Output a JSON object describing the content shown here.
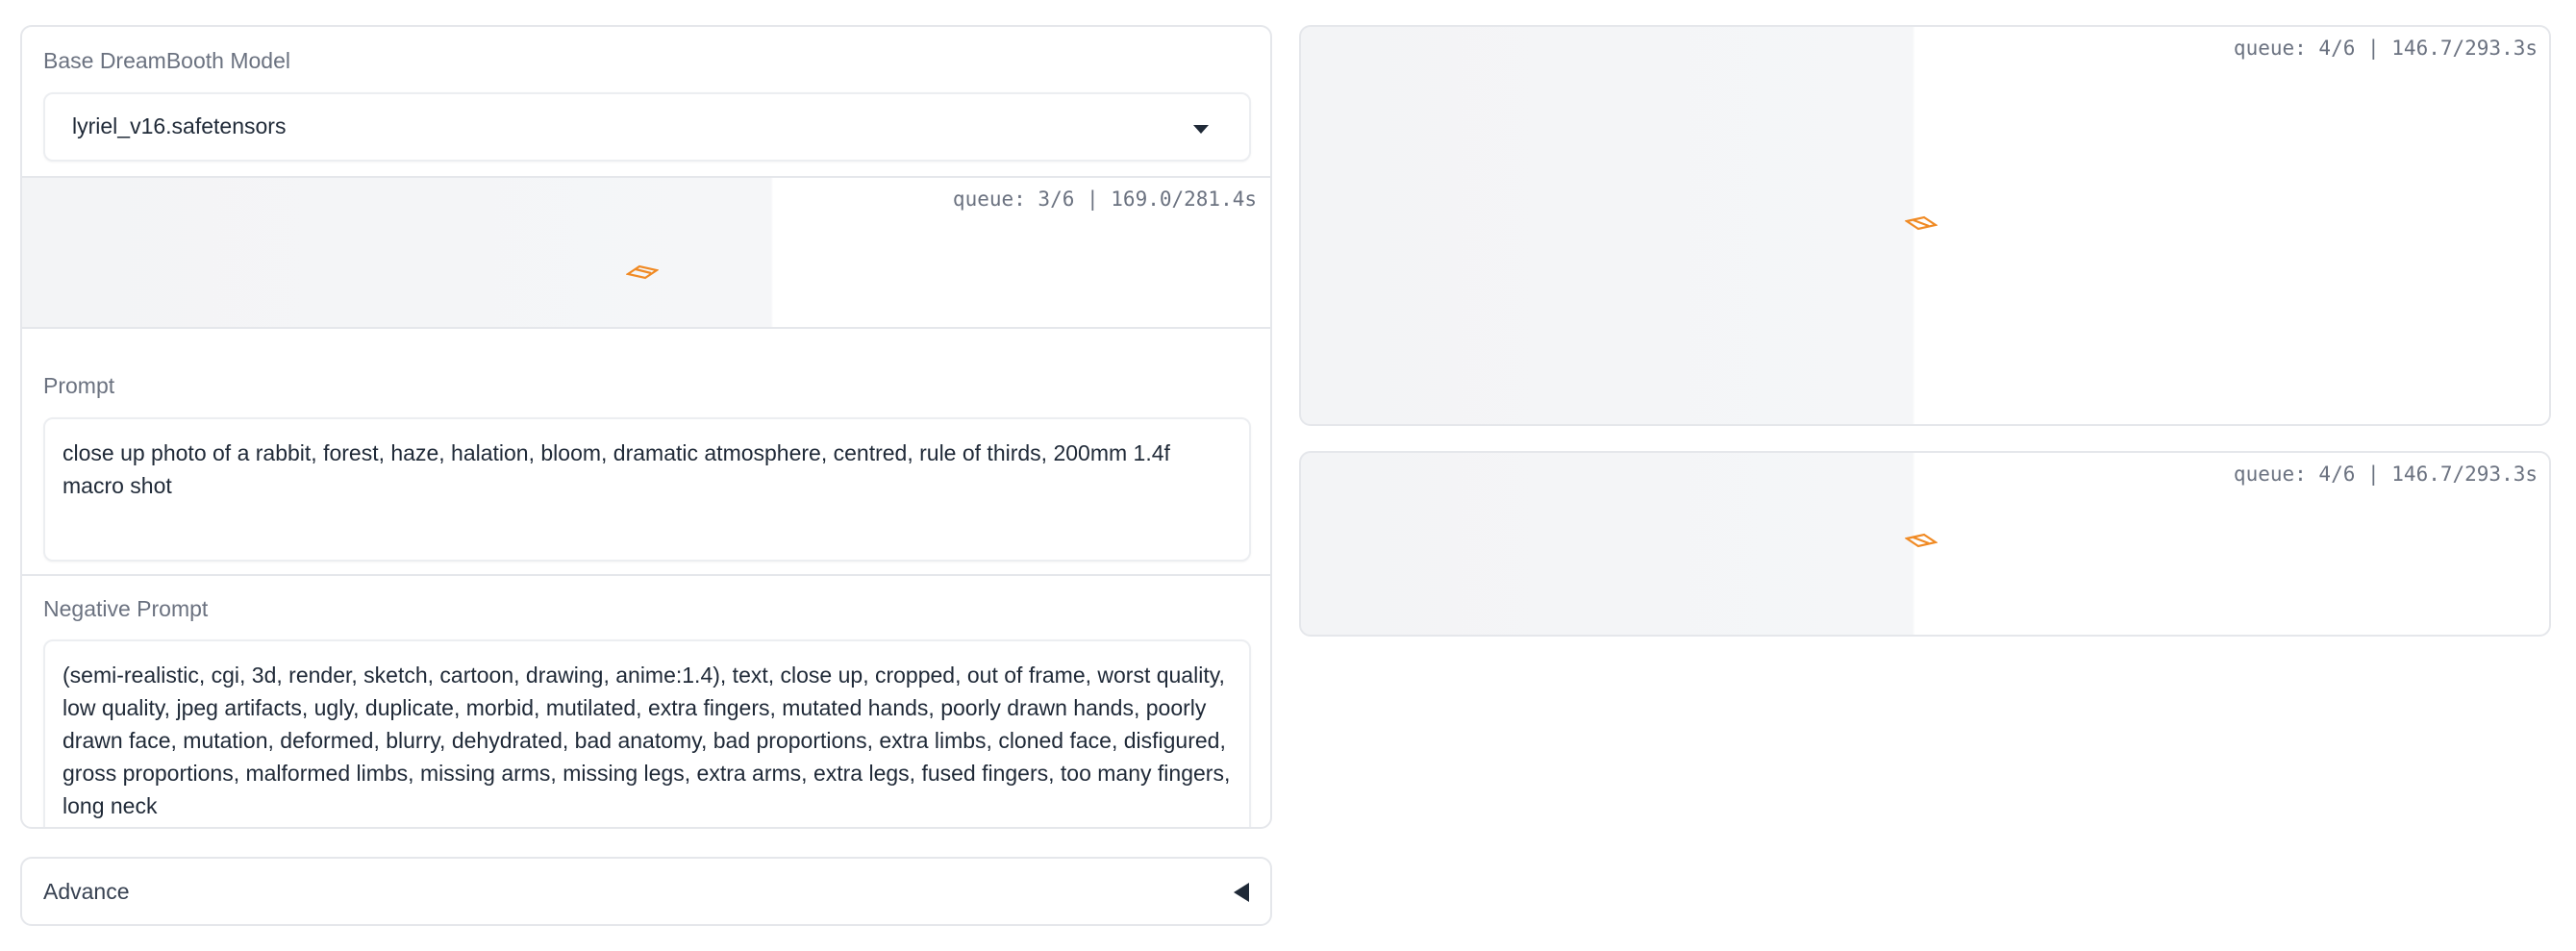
{
  "model_select": {
    "label": "Base DreamBooth Model",
    "value": "lyriel_v16.safetensors"
  },
  "left_status": {
    "queue": "queue: 3/6 | 169.0/281.4s"
  },
  "prompt": {
    "label": "Prompt",
    "value": "close up photo of a rabbit, forest, haze, halation, bloom, dramatic atmosphere, centred, rule of thirds, 200mm 1.4f macro shot"
  },
  "negative_prompt": {
    "label": "Negative Prompt",
    "value": "(semi-realistic, cgi, 3d, render, sketch, cartoon, drawing, anime:1.4), text, close up, cropped, out of frame, worst quality, low quality, jpeg artifacts, ugly, duplicate, morbid, mutilated, extra fingers, mutated hands, poorly drawn hands, poorly drawn face, mutation, deformed, blurry, dehydrated, bad anatomy, bad proportions, extra limbs, cloned face, disfigured, gross proportions, malformed limbs, missing arms, missing legs, extra arms, extra legs, fused fingers, too many fingers, long neck"
  },
  "advance": {
    "label": "Advance",
    "icon": "collapse-arrow-icon"
  },
  "output_gallery": {
    "queue": "queue: 4/6 | 146.7/293.3s"
  },
  "output_info": {
    "queue": "queue: 4/6 | 146.7/293.3s"
  },
  "colors": {
    "loader_orange": "#f97316",
    "border": "#e5e7eb",
    "label": "#6b7280",
    "text": "#1f2937"
  }
}
